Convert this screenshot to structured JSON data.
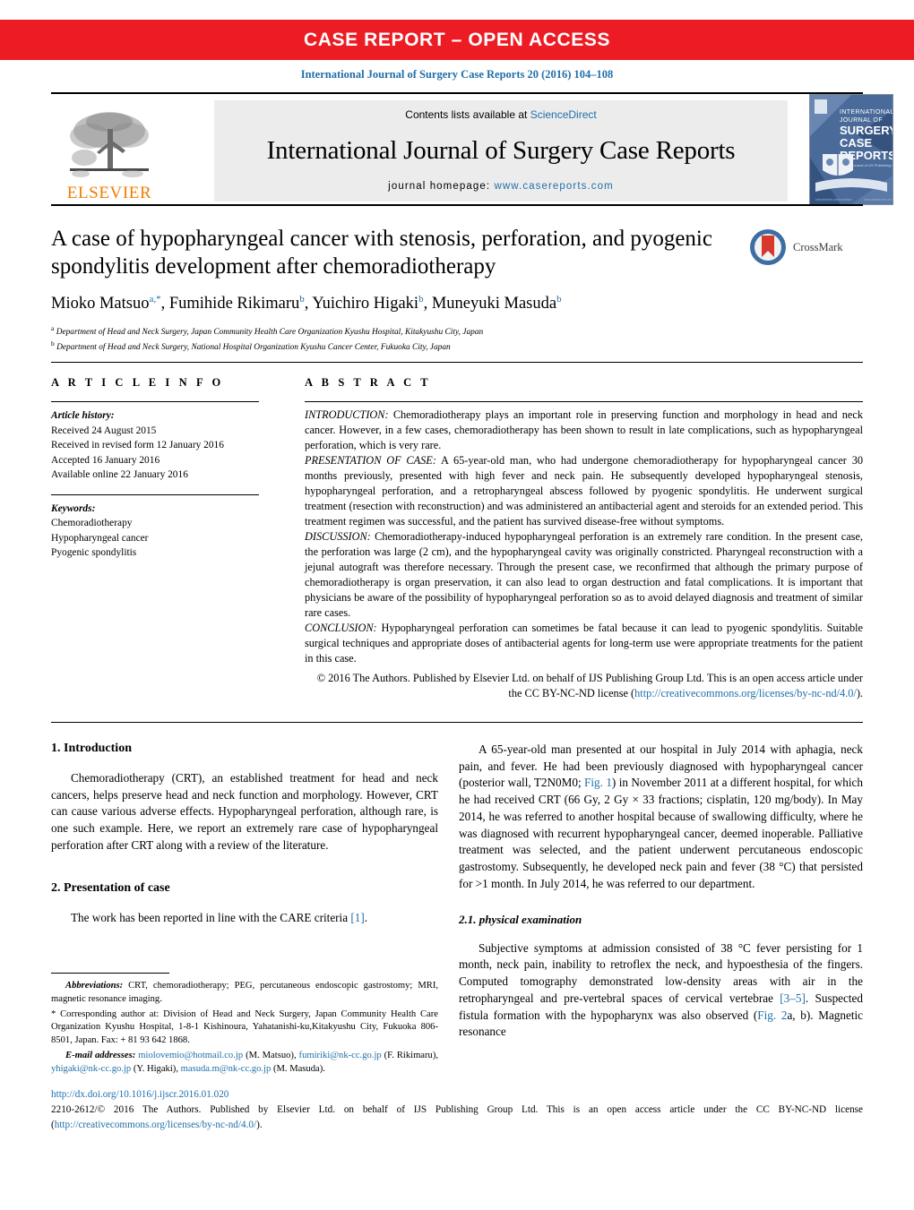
{
  "banner": {
    "label": "CASE REPORT – OPEN ACCESS",
    "color": "#ed1c24"
  },
  "running_head": "International Journal of Surgery Case Reports 20 (2016) 104–108",
  "masthead": {
    "contents_prefix": "Contents lists available at ",
    "sciencedirect": "ScienceDirect",
    "journal_title": "International Journal of Surgery Case Reports",
    "homepage_prefix": "journal homepage: ",
    "homepage_url": "www.casereports.com",
    "publisher_logo_text": "ELSEVIER",
    "cover_lines": [
      "INTERNATIONAL",
      "JOURNAL OF",
      "SURGERY",
      "CASE",
      "REPORTS"
    ],
    "link_color": "#1f6fa8"
  },
  "article": {
    "title": "A case of hypopharyngeal cancer with stenosis, perforation, and pyogenic spondylitis development after chemoradiotherapy",
    "authors_html": "Mioko Matsuo<sup>a,*</sup>, Fumihide Rikimaru<sup>b</sup>, Yuichiro Higaki<sup>b</sup>, Muneyuki Masuda<sup>b</sup>",
    "affiliation_a": "Department of Head and Neck Surgery, Japan Community Health Care Organization Kyushu Hospital, Kitakyushu City, Japan",
    "affiliation_b": "Department of Head and Neck Surgery, National Hospital Organization Kyushu Cancer Center, Fukuoka City, Japan",
    "crossmark_label": "CrossMark"
  },
  "article_info": {
    "heading": "A R T I C L E   I N F O",
    "history_label": "Article history:",
    "history": [
      "Received 24 August 2015",
      "Received in revised form 12 January 2016",
      "Accepted 16 January 2016",
      "Available online 22 January 2016"
    ],
    "keywords_label": "Keywords:",
    "keywords": [
      "Chemoradiotherapy",
      "Hypopharyngeal cancer",
      "Pyogenic spondylitis"
    ]
  },
  "abstract": {
    "heading": "A B S T R A C T",
    "sections": [
      {
        "label": "INTRODUCTION:",
        "text": " Chemoradiotherapy plays an important role in preserving function and morphology in head and neck cancer. However, in a few cases, chemoradiotherapy has been shown to result in late complications, such as hypopharyngeal perforation, which is very rare."
      },
      {
        "label": "PRESENTATION OF CASE:",
        "text": " A 65-year-old man, who had undergone chemoradiotherapy for hypopharyngeal cancer 30 months previously, presented with high fever and neck pain. He subsequently developed hypopharyngeal stenosis, hypopharyngeal perforation, and a retropharyngeal abscess followed by pyogenic spondylitis. He underwent surgical treatment (resection with reconstruction) and was administered an antibacterial agent and steroids for an extended period. This treatment regimen was successful, and the patient has survived disease-free without symptoms."
      },
      {
        "label": "DISCUSSION:",
        "text": " Chemoradiotherapy-induced hypopharyngeal perforation is an extremely rare condition. In the present case, the perforation was large (2 cm), and the hypopharyngeal cavity was originally constricted. Pharyngeal reconstruction with a jejunal autograft was therefore necessary. Through the present case, we reconfirmed that although the primary purpose of chemoradiotherapy is organ preservation, it can also lead to organ destruction and fatal complications. It is important that physicians be aware of the possibility of hypopharyngeal perforation so as to avoid delayed diagnosis and treatment of similar rare cases."
      },
      {
        "label": "CONCLUSION:",
        "text": " Hypopharyngeal perforation can sometimes be fatal because it can lead to pyogenic spondylitis. Suitable surgical techniques and appropriate doses of antibacterial agents for long-term use were appropriate treatments for the patient in this case."
      }
    ],
    "copyright_text": "© 2016 The Authors. Published by Elsevier Ltd. on behalf of IJS Publishing Group Ltd. This is an open access article under the CC BY-NC-ND license (",
    "copyright_url": "http://creativecommons.org/licenses/by-nc-nd/4.0/",
    "copyright_suffix": ")."
  },
  "body": {
    "left": {
      "section1_heading": "1.  Introduction",
      "section1_para": "Chemoradiotherapy (CRT), an established treatment for head and neck cancers, helps preserve head and neck function and morphology. However, CRT can cause various adverse effects. Hypopharyngeal perforation, although rare, is one such example. Here, we report an extremely rare case of hypopharyngeal perforation after CRT along with a review of the literature.",
      "section2_heading": "2.  Presentation of case",
      "section2_para_pre": "The work has been reported in line with the CARE criteria ",
      "section2_ref": "[1]",
      "section2_para_post": "."
    },
    "right": {
      "para1_a": "A 65-year-old man presented at our hospital in July 2014 with aphagia, neck pain, and fever. He had been previously diagnosed with hypopharyngeal cancer (posterior wall, T2N0M0; ",
      "para1_fig1": "Fig. 1",
      "para1_b": ") in November 2011 at a different hospital, for which he had received CRT (66 Gy, 2 Gy × 33 fractions; cisplatin, 120 mg/body). In May 2014, he was referred to another hospital because of swallowing difficulty, where he was diagnosed with recurrent hypopharyngeal cancer, deemed inoperable. Palliative treatment was selected, and the patient underwent percutaneous endoscopic gastrostomy. Subsequently, he developed neck pain and fever (38 °C) that persisted for >1 month. In July 2014, he was referred to our department.",
      "subsection_heading": "2.1.  physical examination",
      "para2_a": "Subjective symptoms at admission consisted of 38 °C fever persisting for 1 month, neck pain, inability to retroflex the neck, and hypoesthesia of the fingers. Computed tomography demonstrated low-density areas with air in the retropharyngeal and pre-vertebral spaces of cervical vertebrae ",
      "para2_ref": "[3–5]",
      "para2_b": ". Suspected fistula formation with the hypopharynx was also observed (",
      "para2_fig2": "Fig. 2",
      "para2_c": "a, b). Magnetic resonance"
    }
  },
  "footnotes": {
    "abbreviations_label": "Abbreviations:",
    "abbreviations_text": " CRT, chemoradiotherapy; PEG, percutaneous endoscopic gastrostomy; MRI, magnetic resonance imaging.",
    "corresponding_text": "* Corresponding author at: Division of Head and Neck Surgery, Japan Community Health Care Organization Kyushu Hospital, 1-8-1 Kishinoura, Yahatanishi-ku,Kitakyushu City, Fukuoka 806-8501, Japan. Fax: + 81 93 642 1868.",
    "email_label": "E-mail addresses:",
    "emails": [
      {
        "address": "miolovemio@hotmail.co.jp",
        "name": " (M. Matsuo), "
      },
      {
        "address": "fumiriki@nk-cc.go.jp",
        "name": " (F. Rikimaru), "
      },
      {
        "address": "yhigaki@nk-cc.go.jp",
        "name": " (Y. Higaki), "
      },
      {
        "address": "masuda.m@nk-cc.go.jp",
        "name": " (M. Masuda)."
      }
    ]
  },
  "footer": {
    "doi": "http://dx.doi.org/10.1016/j.ijscr.2016.01.020",
    "issn_text": "2210-2612/© 2016 The Authors. Published by Elsevier Ltd. on behalf of IJS Publishing Group Ltd. This is an open access article under the CC BY-NC-ND license (",
    "issn_url": "http://creativecommons.org/licenses/by-nc-nd/4.0/",
    "issn_suffix": ")."
  }
}
